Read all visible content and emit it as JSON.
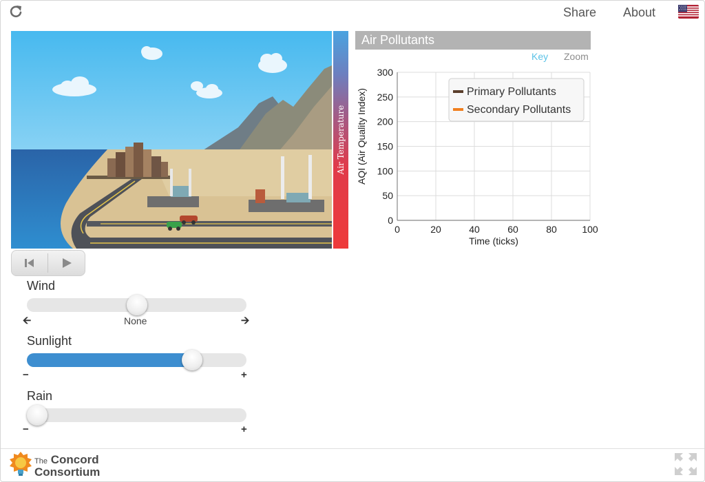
{
  "header": {
    "reload_icon": "reload-icon",
    "share_label": "Share",
    "about_label": "About",
    "language_icon": "us-flag-icon"
  },
  "scene": {
    "thermometer_label": "Air Temperature"
  },
  "graph": {
    "title": "Air Pollutants",
    "key_label": "Key",
    "zoom_label": "Zoom",
    "colors": {
      "key_link": "#5bc2e7",
      "primary": "#5a3e2b",
      "secondary": "#f07f1e"
    }
  },
  "chart_data": {
    "type": "line",
    "xlabel": "Time (ticks)",
    "ylabel": "AQI (Air Quality Index)",
    "xlim": [
      0,
      100
    ],
    "ylim": [
      0,
      300
    ],
    "xticks": [
      "0",
      "20",
      "40",
      "60",
      "80",
      "100"
    ],
    "yticks": [
      "0",
      "50",
      "100",
      "150",
      "200",
      "250",
      "300"
    ],
    "grid": true,
    "legend_placement": "top-right",
    "series": [
      {
        "name": "Primary Pollutants",
        "color": "#5a3e2b",
        "values": []
      },
      {
        "name": "Secondary Pollutants",
        "color": "#f07f1e",
        "values": []
      }
    ]
  },
  "controls": {
    "reset_icon": "skip-back-icon",
    "play_icon": "play-icon"
  },
  "sliders": {
    "wind": {
      "label": "Wind",
      "caption": "None",
      "value": 0.5,
      "min_icon": "arrow-left-icon",
      "max_icon": "arrow-right-icon"
    },
    "sunlight": {
      "label": "Sunlight",
      "value": 0.78,
      "min_icon": "minus-icon",
      "max_icon": "plus-icon"
    },
    "rain": {
      "label": "Rain",
      "value": 0.0,
      "min_icon": "minus-icon",
      "max_icon": "plus-icon"
    }
  },
  "footer": {
    "logo_small": "The",
    "logo_line1": "Concord",
    "logo_line2": "Consortium",
    "logo_icon": "lightbulb-icon",
    "fullscreen_icon": "fullscreen-icon"
  }
}
